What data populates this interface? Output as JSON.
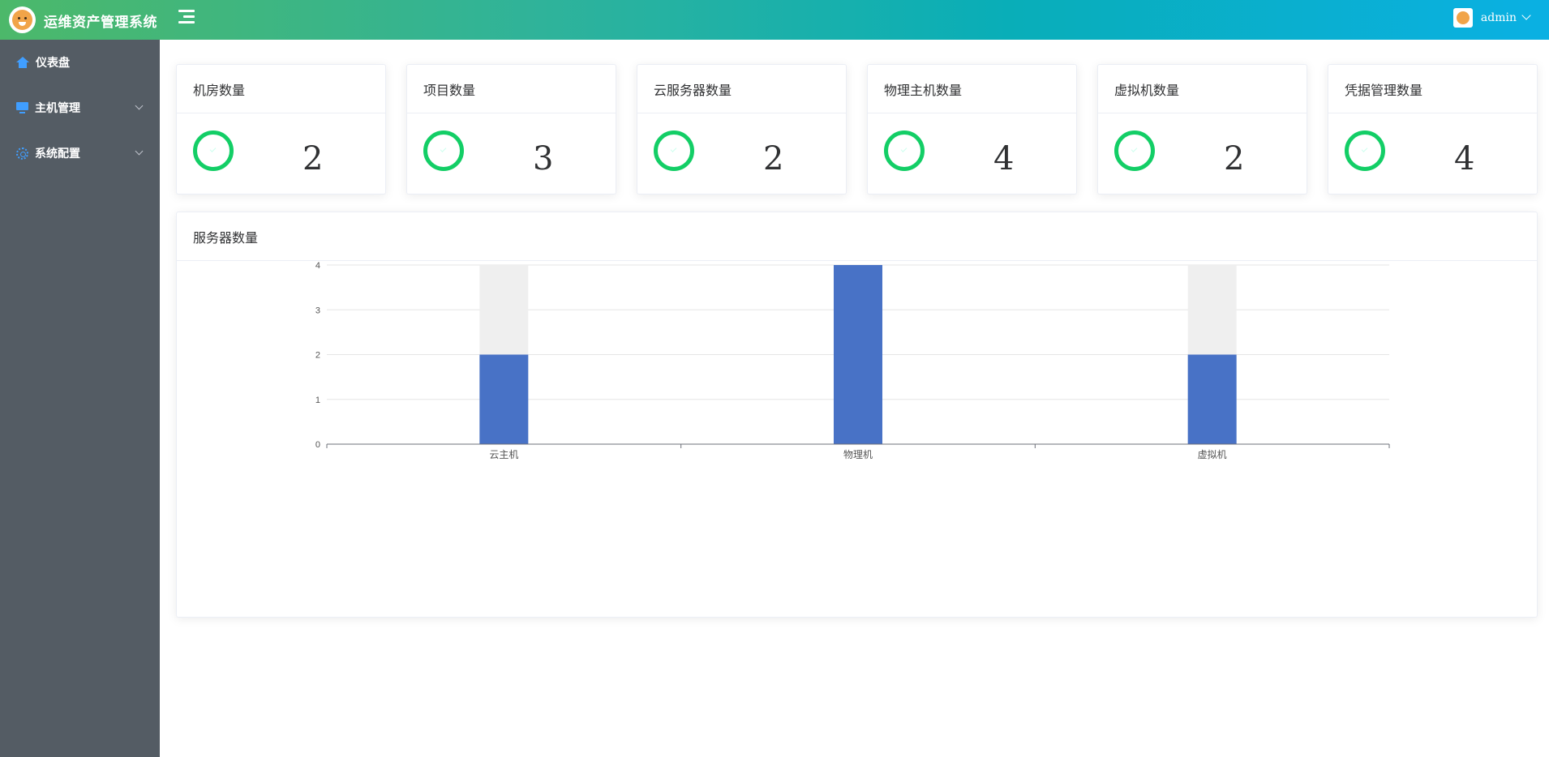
{
  "app": {
    "title": "运维资产管理系统"
  },
  "header": {
    "user_name": "admin"
  },
  "sidebar": {
    "items": [
      {
        "label": "仪表盘",
        "icon": "home-icon"
      },
      {
        "label": "主机管理",
        "icon": "monitor-icon"
      },
      {
        "label": "系统配置",
        "icon": "gear-icon"
      }
    ]
  },
  "stats": [
    {
      "title": "机房数量",
      "value": "2"
    },
    {
      "title": "项目数量",
      "value": "3"
    },
    {
      "title": "云服务器数量",
      "value": "2"
    },
    {
      "title": "物理主机数量",
      "value": "4"
    },
    {
      "title": "虚拟机数量",
      "value": "2"
    },
    {
      "title": "凭据管理数量",
      "value": "4"
    }
  ],
  "chart_card": {
    "title": "服务器数量"
  },
  "chart_data": {
    "type": "bar",
    "categories": [
      "云主机",
      "物理机",
      "虚拟机"
    ],
    "values": [
      2,
      4,
      2
    ],
    "background_max": 4,
    "ylim": [
      0,
      4
    ],
    "yticks": [
      0,
      1,
      2,
      3,
      4
    ],
    "grid": true,
    "colors": {
      "bar": "#4872c6",
      "background": "#efefef",
      "grid": "#e6e6e6",
      "axis": "#6e7079"
    }
  }
}
